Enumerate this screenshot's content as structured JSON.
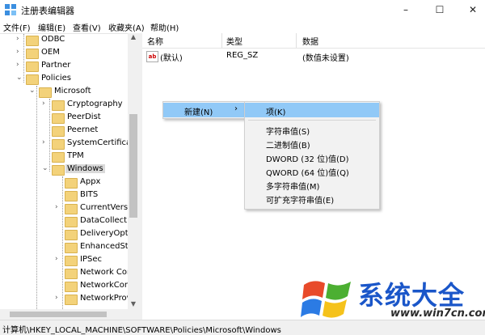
{
  "window": {
    "title": "注册表编辑器",
    "minimize": "–",
    "maximize": "☐",
    "close": "✕"
  },
  "menu": [
    "文件(F)",
    "编辑(E)",
    "查看(V)",
    "收藏夹(A)",
    "帮助(H)"
  ],
  "tree": [
    {
      "label": "ODBC",
      "arrow": "›"
    },
    {
      "label": "OEM",
      "arrow": "›"
    },
    {
      "label": "Partner",
      "arrow": "›"
    },
    {
      "label": "Policies",
      "arrow": "⌄"
    },
    {
      "label": "Microsoft",
      "arrow": "⌄"
    },
    {
      "label": "Cryptography",
      "arrow": "›"
    },
    {
      "label": "PeerDist",
      "arrow": ""
    },
    {
      "label": "Peernet",
      "arrow": ""
    },
    {
      "label": "SystemCertificates",
      "arrow": "›"
    },
    {
      "label": "TPM",
      "arrow": ""
    },
    {
      "label": "Windows",
      "arrow": "⌄",
      "selected": true
    },
    {
      "label": "Appx",
      "arrow": ""
    },
    {
      "label": "BITS",
      "arrow": ""
    },
    {
      "label": "CurrentVersion",
      "arrow": "›"
    },
    {
      "label": "DataCollection",
      "arrow": ""
    },
    {
      "label": "DeliveryOptimization",
      "arrow": ""
    },
    {
      "label": "EnhancedStorage",
      "arrow": ""
    },
    {
      "label": "IPSec",
      "arrow": "›"
    },
    {
      "label": "Network Connections",
      "arrow": ""
    },
    {
      "label": "NetworkConnectivity",
      "arrow": ""
    },
    {
      "label": "NetworkProvider",
      "arrow": "›"
    }
  ],
  "columns": {
    "name": "名称",
    "type": "类型",
    "data": "数据"
  },
  "row": {
    "icon": "ab",
    "name": "(默认)",
    "type": "REG_SZ",
    "data": "(数值未设置)"
  },
  "context": {
    "new_label": "新建(N)",
    "new_arrow": "›",
    "submenu": [
      "项(K)",
      "字符串值(S)",
      "二进制值(B)",
      "DWORD (32 位)值(D)",
      "QWORD (64 位)值(Q)",
      "多字符串值(M)",
      "可扩充字符串值(E)"
    ]
  },
  "status": "计算机\\HKEY_LOCAL_MACHINE\\SOFTWARE\\Policies\\Microsoft\\Windows",
  "watermark": {
    "text": "系统大全",
    "url": "www.win7cn.com"
  },
  "colors": {
    "highlight": "#91c9f7",
    "folder": "#f3d27a",
    "watermark_blue": "#1a56c9"
  }
}
